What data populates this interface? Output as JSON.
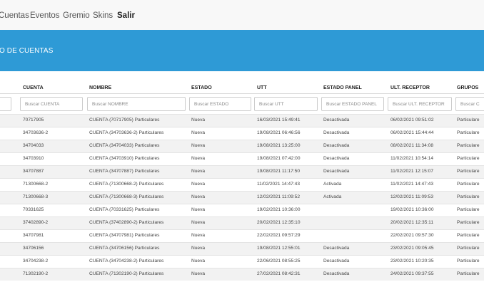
{
  "nav": {
    "items": [
      "Cuentas",
      "Eventos",
      "Gremio",
      "Skins",
      "Salir"
    ]
  },
  "banner": {
    "title": "O DE CUENTAS"
  },
  "table": {
    "headers": [
      "CUENTA",
      "NOMBRE",
      "ESTADO",
      "UTT",
      "ESTADO PANEL",
      "ULT. RECEPTOR",
      "GRUPOS"
    ],
    "filters": [
      "Buscar CUENTA",
      "Buscar NOMBRE",
      "Buscar ESTADO",
      "Buscar UTT",
      "Buscar ESTADO PANEL",
      "Buscar ULT. RECEPTOR",
      "Buscar C"
    ],
    "rows": [
      [
        "70717905",
        "CUENTA (70717905) Particulares",
        "Nueva",
        "16/03/2021 15:49:41",
        "Desactivada",
        "06/02/2021 09:51:02",
        "Particulare"
      ],
      [
        "34703636-2",
        "CUENTA (34703636-2) Particulares",
        "Nueva",
        "19/08/2021 06:46:56",
        "Desactivada",
        "06/02/2021 15:44:44",
        "Particulare"
      ],
      [
        "34704033",
        "CUENTA (34704033) Particulares",
        "Nueva",
        "19/08/2021 13:25:00",
        "Desactivada",
        "08/02/2021 11:34:08",
        "Particulare"
      ],
      [
        "34703910",
        "CUENTA (34703910) Particulares",
        "Nueva",
        "19/08/2021 07:42:00",
        "Desactivada",
        "11/02/2021 10:54:14",
        "Particulare"
      ],
      [
        "34707887",
        "CUENTA (34707887) Particulares",
        "Nueva",
        "19/08/2021 11:17:50",
        "Desactivada",
        "11/02/2021 12:15:07",
        "Particulare"
      ],
      [
        "71300668-2",
        "CUENTA (71300668-2) Particulares",
        "Nueva",
        "11/02/2021 14:47:43",
        "Activada",
        "11/02/2021 14:47:43",
        "Particulare"
      ],
      [
        "71300668-3",
        "CUENTA (71300668-3) Particulares",
        "Nueva",
        "12/02/2021 11:09:52",
        "Activada",
        "12/02/2021 11:09:53",
        "Particulare"
      ],
      [
        "70331625",
        "CUENTA (70331625) Particulares",
        "Nueva",
        "19/02/2021 10:36:00",
        "",
        "19/02/2021 10:36:00",
        "Particulare"
      ],
      [
        "37402890-2",
        "CUENTA (37402890-2) Particulares",
        "Nueva",
        "20/02/2021 12:35:10",
        "",
        "20/02/2021 12:35:11",
        "Particulare"
      ],
      [
        "34707981",
        "CUENTA (34707981) Particulares",
        "Nueva",
        "22/02/2021 09:57:29",
        "",
        "22/02/2021 09:57:30",
        "Particulare"
      ],
      [
        "34706156",
        "CUENTA (34706156) Particulares",
        "Nueva",
        "19/08/2021 12:55:01",
        "Desactivada",
        "23/02/2021 09:05:45",
        "Particulare"
      ],
      [
        "34704238-2",
        "CUENTA (34704238-2) Particulares",
        "Nueva",
        "22/06/2021 08:55:25",
        "Desactivada",
        "23/02/2021 10:20:35",
        "Particulare"
      ],
      [
        "71302190-2",
        "CUENTA (71302190-2) Particulares",
        "Nueva",
        "27/02/2021 08:42:31",
        "Desactivada",
        "24/02/2021 09:37:55",
        "Particulare"
      ]
    ]
  }
}
